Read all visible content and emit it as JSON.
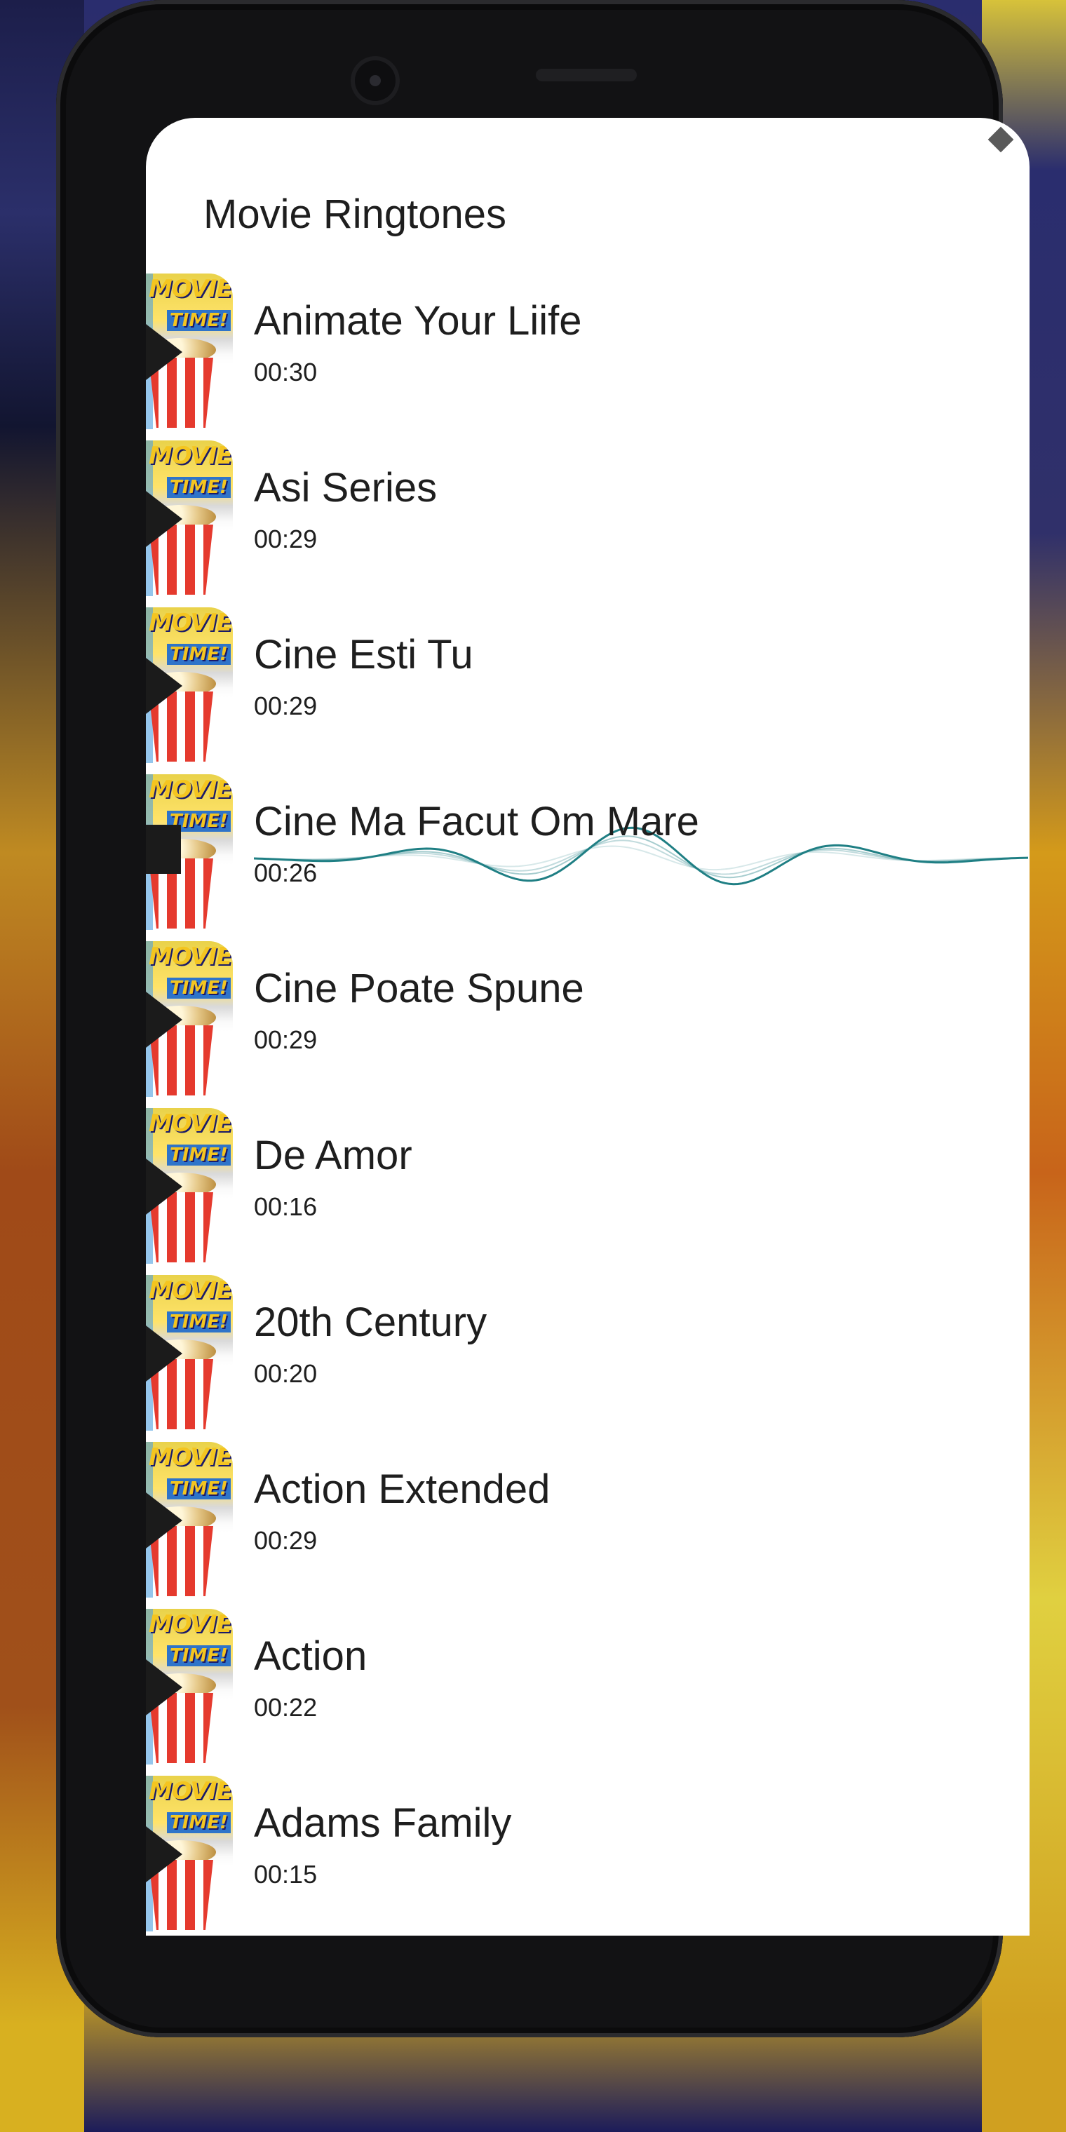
{
  "app": {
    "title": "Movie Ringtones"
  },
  "ringtones": [
    {
      "title": "Animate Your Liife",
      "duration": "00:30",
      "state": "paused"
    },
    {
      "title": "Asi Series",
      "duration": "00:29",
      "state": "paused"
    },
    {
      "title": "Cine Esti Tu",
      "duration": "00:29",
      "state": "paused"
    },
    {
      "title": "Cine Ma Facut Om Mare",
      "duration": "00:26",
      "state": "playing"
    },
    {
      "title": "Cine Poate Spune",
      "duration": "00:29",
      "state": "paused"
    },
    {
      "title": "De Amor",
      "duration": "00:16",
      "state": "paused"
    },
    {
      "title": "20th Century",
      "duration": "00:20",
      "state": "paused"
    },
    {
      "title": "Action Extended",
      "duration": "00:29",
      "state": "paused"
    },
    {
      "title": "Action",
      "duration": "00:22",
      "state": "paused"
    },
    {
      "title": "Adams Family",
      "duration": "00:15",
      "state": "paused"
    }
  ],
  "thumbnail": {
    "logo_line1": "MOVIE",
    "logo_line2": "TIME!"
  },
  "colors": {
    "wave_accent": "#1f7f84",
    "text": "#1e1e1e"
  },
  "icons": {
    "play": "play-icon",
    "pause": "pause-icon"
  }
}
